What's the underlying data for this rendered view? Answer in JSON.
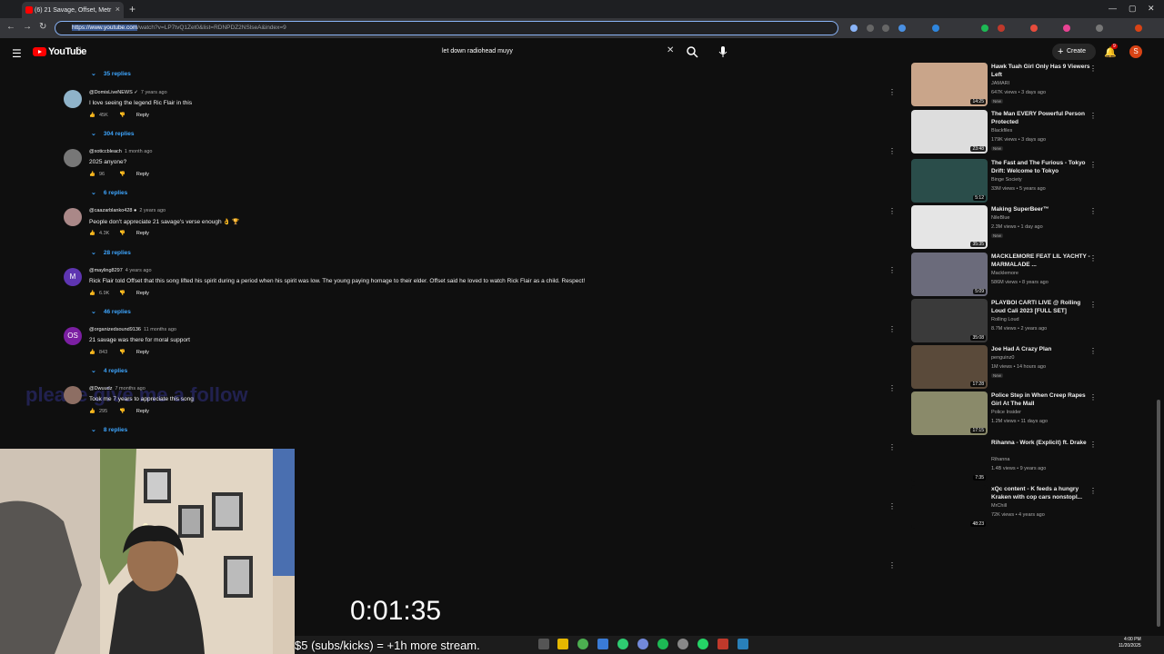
{
  "browser": {
    "tab_title": "(6) 21 Savage, Offset, Metr",
    "url_prefix": "https://www.youtube.com",
    "url_rest": "/watch?v=LP7tvQ1Zet0&list=RDNPDZ2NSlseA&index=9"
  },
  "header": {
    "logo": "YouTube",
    "logo_sup": "IN",
    "search_query": "let down radiohead muyy",
    "create_label": "Create",
    "notif_count": "9",
    "avatar_letter": "S"
  },
  "comments": [
    {
      "replies_label": "35 replies"
    },
    {
      "user": "@DomisLiveNEWS",
      "verified_mark": "✓",
      "ago": "7 years ago",
      "text": "I love seeing the legend Ric Flair in this",
      "likes": "45K",
      "reply": "Reply",
      "replies_label": "304 replies",
      "avatar_color": "#8fb3c9",
      "avatar_letter": ""
    },
    {
      "user": "@xoticcbleach",
      "ago": "1 month ago",
      "text": "2025 anyone?",
      "likes": "96",
      "reply": "Reply",
      "replies_label": "6 replies",
      "avatar_color": "#777",
      "avatar_letter": ""
    },
    {
      "user": "@caazarblanko428",
      "verified_mark": "●",
      "ago": "2 years ago",
      "text": "People don't appreciate 21 savage's verse enough 👌 🏆",
      "likes": "4.3K",
      "reply": "Reply",
      "replies_label": "28 replies",
      "avatar_color": "#a88",
      "avatar_letter": ""
    },
    {
      "user": "@mayling8297",
      "ago": "4 years ago",
      "text": "Rick Flair told Offset that this song lifted his spirit during a period when his spirit was low. The young paying homage to their elder. Offset said he loved to watch Rick Flair as a child. Respect!",
      "likes": "6.9K",
      "reply": "Reply",
      "replies_label": "46 replies",
      "avatar_color": "#5e35b1",
      "avatar_letter": "M"
    },
    {
      "user": "@organizedsound9136",
      "ago": "11 months ago",
      "text": "21 savage was there for moral support",
      "likes": "843",
      "reply": "Reply",
      "replies_label": "4 replies",
      "avatar_color": "#7b1fa2",
      "avatar_letter": "OS"
    },
    {
      "user": "@Dwuudz",
      "ago": "7 months ago",
      "text": "Took me 7 years to appreciate this song",
      "likes": "295",
      "reply": "Reply",
      "replies_label": "8 replies",
      "avatar_color": "#8d6e63",
      "avatar_letter": ""
    }
  ],
  "overlay_text": "please give me a follow",
  "sidebar": [
    {
      "title": "Hawk Tuah Girl Only Has 9 Viewers Left",
      "channel": "JAMARI",
      "meta": "647K views • 3 days ago",
      "badge": "New",
      "duration": "14:25",
      "thumb": "#c9a58a"
    },
    {
      "title": "The Man EVERY Powerful Person Protected",
      "channel": "Blackfiles",
      "meta": "179K views • 3 days ago",
      "badge": "New",
      "duration": "23:48",
      "thumb": "#ddd"
    },
    {
      "title": "The Fast and The Furious - Tokyo Drift: Welcome to Tokyo",
      "channel": "Binge Society",
      "meta": "33M views • 5 years ago",
      "badge": "",
      "duration": "5:12",
      "thumb": "#2a4d4a"
    },
    {
      "title": "Making SuperBeer™",
      "channel": "NileBlue",
      "meta": "2.3M views • 1 day ago",
      "badge": "New",
      "duration": "35:35",
      "thumb": "#e5e5e5"
    },
    {
      "title": "MACKLEMORE FEAT LIL YACHTY - MARMALADE ...",
      "channel": "Macklemore",
      "meta": "586M views • 8 years ago",
      "badge": "",
      "duration": "5:09",
      "thumb": "#6b6b7b"
    },
    {
      "title": "PLAYBOI CARTI LIVE @ Rolling Loud Cali 2023 [FULL SET]",
      "channel": "Rolling Loud",
      "meta": "8.7M views • 2 years ago",
      "badge": "",
      "duration": "35:08",
      "thumb": "#3a3a3a"
    },
    {
      "title": "Joe Had A Crazy Plan",
      "channel": "penguinz0",
      "meta": "1M views • 14 hours ago",
      "badge": "New",
      "duration": "17:28",
      "thumb": "#5a4a3a"
    },
    {
      "title": "Police Step in When Creep Rapes Girl At The Mall",
      "channel": "Police Insider",
      "meta": "1.2M views • 11 days ago",
      "badge": "",
      "duration": "17:15",
      "thumb": "#8a8a6a"
    },
    {
      "title": "Rihanna - Work (Explicit) ft. Drake",
      "channel": "Rihanna",
      "meta": "1.4B views • 9 years ago",
      "badge": "",
      "duration": "7:35",
      "thumb": "#0f0f0f"
    },
    {
      "title": "xQc content - K feeds a hungry Kraken with cop cars nonstopl...",
      "channel": "MrChill",
      "meta": "72K views • 4 years ago",
      "badge": "",
      "duration": "48:23",
      "thumb": "#0f0f0f"
    }
  ],
  "stream": {
    "timer": "0:01:35",
    "ticker": "$5 (subs/kicks) = +1h more stream."
  },
  "clock": {
    "time": "4:00 PM",
    "date": "11/20/2025"
  }
}
